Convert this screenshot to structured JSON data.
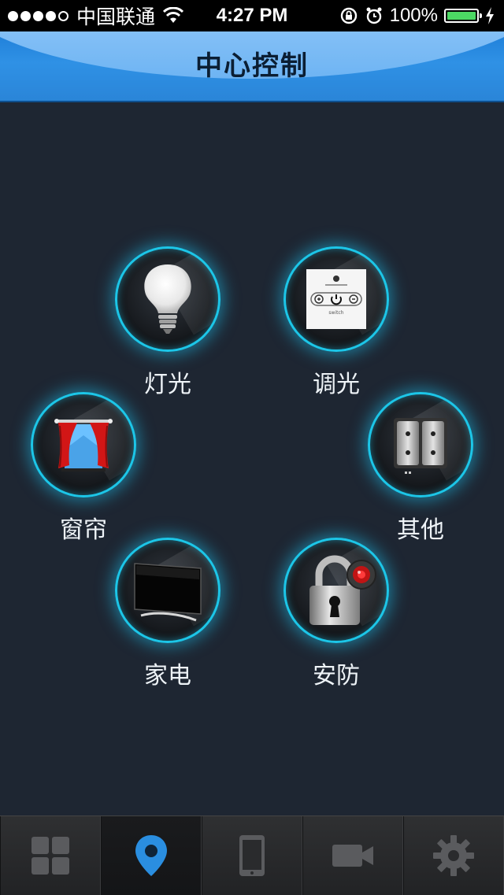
{
  "status_bar": {
    "carrier": "中国联通",
    "time": "4:27 PM",
    "battery_percent": "100%",
    "battery_level": 1.0,
    "signal_bars_filled": 4,
    "signal_bars_total": 5,
    "icons": [
      "wifi-icon",
      "rotation-lock-icon",
      "alarm-icon",
      "charging-icon"
    ]
  },
  "nav": {
    "title": "中心控制"
  },
  "tiles": [
    {
      "id": "lighting",
      "label": "灯光",
      "icon": "light-bulb-icon"
    },
    {
      "id": "dimming",
      "label": "调光",
      "icon": "dimmer-switch-icon",
      "device_caption": "switch"
    },
    {
      "id": "curtains",
      "label": "窗帘",
      "icon": "curtain-icon"
    },
    {
      "id": "other",
      "label": "其他",
      "icon": "wall-switch-icon"
    },
    {
      "id": "appliances",
      "label": "家电",
      "icon": "television-icon"
    },
    {
      "id": "security",
      "label": "安防",
      "icon": "padlock-camera-icon"
    }
  ],
  "tab_bar": {
    "active_index": 1,
    "tabs": [
      {
        "id": "grid",
        "icon": "grid-icon"
      },
      {
        "id": "location",
        "icon": "location-pin-icon"
      },
      {
        "id": "tablet",
        "icon": "tablet-icon"
      },
      {
        "id": "camera",
        "icon": "video-camera-icon"
      },
      {
        "id": "settings",
        "icon": "gear-icon"
      }
    ]
  },
  "colors": {
    "accent_glow": "#1cc6e8",
    "nav_blue": "#2f91e5",
    "background": "#1e2632",
    "active_tab_icon": "#2a8ee0"
  }
}
